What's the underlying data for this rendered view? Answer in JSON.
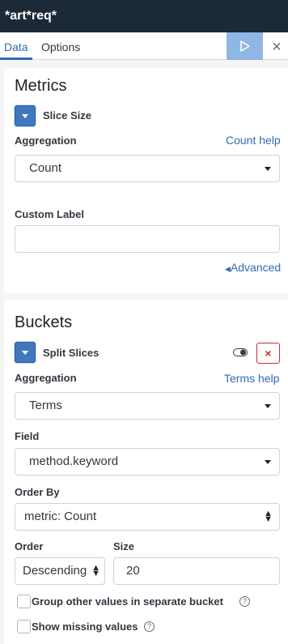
{
  "title": "*art*req*",
  "tabs": {
    "data": "Data",
    "options": "Options"
  },
  "metrics": {
    "heading": "Metrics",
    "agg_name": "Slice Size",
    "aggregation_label": "Aggregation",
    "help": "Count help",
    "aggregation_value": "Count",
    "custom_label": "Custom Label",
    "custom_label_value": "",
    "advanced": "Advanced"
  },
  "buckets": {
    "heading": "Buckets",
    "agg_name": "Split Slices",
    "aggregation_label": "Aggregation",
    "help": "Terms help",
    "aggregation_value": "Terms",
    "field_label": "Field",
    "field_value": "method.keyword",
    "order_by_label": "Order By",
    "order_by_value": "metric: Count",
    "order_label": "Order",
    "order_value": "Descending",
    "size_label": "Size",
    "size_value": "20",
    "group_other": "Group other values in separate bucket",
    "show_missing": "Show missing values"
  },
  "colors": {
    "accent": "#2f6db3",
    "titlebar": "#1c2a37",
    "danger": "#c8312a"
  }
}
